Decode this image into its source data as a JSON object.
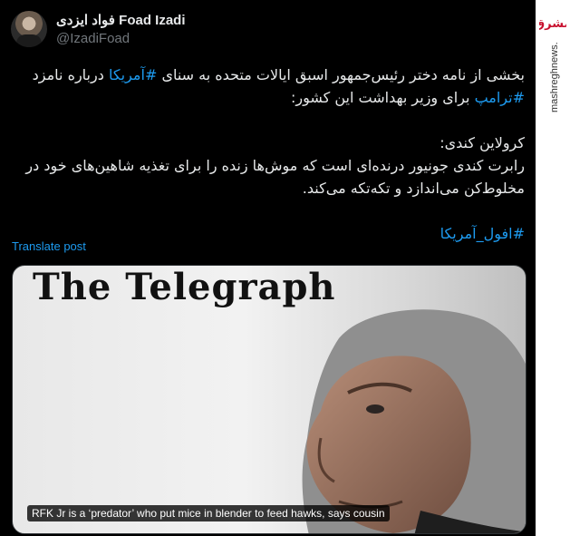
{
  "author": {
    "name_fa": "فواد ایزدی",
    "name_en": "Foad Izadi",
    "handle": "@IzadiFoad"
  },
  "tweet": {
    "para1_a": "بخشی از نامه دختر رئیس‌جمهور اسبق ایالات متحده به سنای ",
    "hashtag_america": "#آمریکا",
    "para1_b": " درباره نامزد ",
    "hashtag_trump": "#ترامپ",
    "para1_c": " برای وزیر بهداشت این کشور:",
    "para2_line1": "کرولاین کندی:",
    "para2_line2": "رابرت کندی جونیور درنده‌ای است که موش‌ها زنده را برای تغذیه شاهین‌های خود در مخلوط‌کن می‌اندازد و تکه‌تکه می‌کند.",
    "hashtag_decline": "#افول_آمریکا"
  },
  "translate_label": "Translate post",
  "media": {
    "masthead": "The Telegraph",
    "caption": "RFK Jr is a ‘predator’ who put mice in blender to feed hawks, says cousin"
  },
  "watermark": {
    "logo_text": "مشرق",
    "site": "mashreghnews.ir",
    "color": "#c8102e"
  }
}
